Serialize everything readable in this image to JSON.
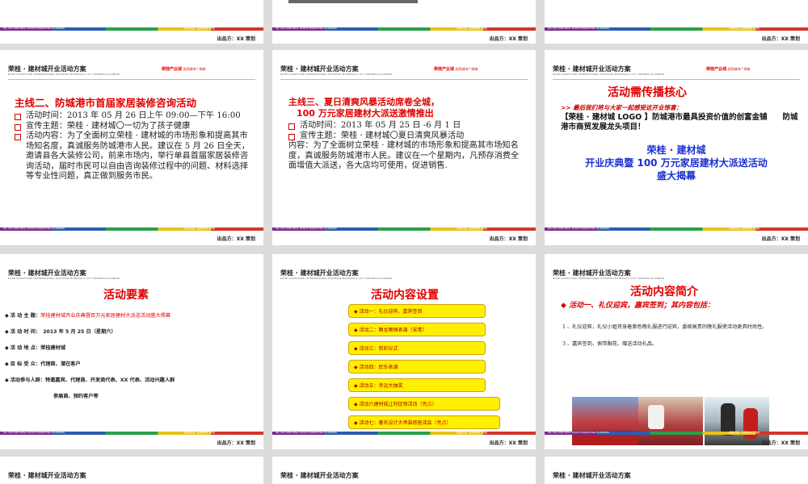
{
  "footer": {
    "stripe_left": "GR. POU RMS REAL ESTATE MARKETING PLANNING",
    "stripe_right": "[荣桂出品 · 优质城市广场城]",
    "by": "出品方：XX 策划"
  },
  "header": {
    "title": "荣桂 · 建材城开业活动方案",
    "subtitle": "ROSE COURTYARD INTERNATIONAL BUILDING MATERIALS CITY OPENING PLANNING",
    "brand": "荣桂产业城",
    "brand_sub": "优质城市广场城"
  },
  "slide4": {
    "heading": "主线二、防城港市首届家居装修咨询活动",
    "b1": "活动时间：2013 年 05 月 26 日上午 09:00—下午 16:00",
    "b2": "宣传主题：荣桂 · 建材城〇一切为了孩子健康",
    "b3": "活动内容：为了全面树立荣桂 · 建材城的市场形象和提高其市场知名度，真诚服务防城港市人民。建议在 5 月 26 日全天，邀请县各大装修公司，前来市场内，举行单县首届家居装修咨询活动，届时市民可以自由咨询装修过程中的问题、材料选择等专业性问题，真正做到服务市民。"
  },
  "slide5": {
    "heading1": "主线三、夏日清爽风暴活动席卷全城，",
    "heading2": "100 万元家居建材大派送激情推出",
    "b1": "活动时间：2013 年 05 月 25 日 -6 月 1 日",
    "b2": "宣传主题：荣桂 · 建材城〇夏日清爽风暴活动",
    "b3": "内容：为了全面树立荣桂 · 建材城的市场形象和提高其市场知名度，真诚服务防城港市人民。建议在一个星期内，凡预存消费全面增值大派送，各大店均可使用，促进销售."
  },
  "slide6": {
    "heading": "活动需传播核心",
    "intro": ">> 最后我们将与大家一起感受这开业惊喜：",
    "line1": "【荣桂 · 建材城 LOGO 】防城港市最具投资价值的创富金铺　　防城港市商贸发展龙头项目！",
    "blue1": "荣桂 · 建材城",
    "blue2": "开业庆典暨 100 万元家居建材大派送活动",
    "blue3": "盛大揭幕"
  },
  "slide7": {
    "heading": "活动要素",
    "r1_label": "活 动 主 题：",
    "r1_value": "荣桂建材城开业庆典暨百万元家居建材大派送活动盛大揭幕",
    "r2": "活 动 时 间：　2013 年 5 月 25 日（星期六）",
    "r3": "活 动 地 点：荣桂建材城",
    "r4": "目 标 受 众：代理商、潜在客户",
    "r5": "活动参与人群：特邀嘉宾、代理商、开发商代表、XX 代表、活动兴趣人群",
    "r6": "参展商、预约客户等"
  },
  "slide8": {
    "heading": "活动内容设置",
    "items": [
      "活动一：礼仪迎宾、嘉宾签到",
      "活动二：舞龙舞狮表演（采青）",
      "活动三：剪彩仪式",
      "活动四：民乐表演",
      "活动五：幸运大抽奖",
      "活动六建材城让利促销活动",
      "活动七：著名设计大师装修座谈会"
    ],
    "highlight": "（亮点）"
  },
  "slide9": {
    "heading": "活动内容简介",
    "sub": "◆ 活动一、礼仪迎宾，嘉宾签到；其内容包括：",
    "p1": "1 、礼仪迎宾，礼仪小姐将身着紫色晚礼服进行迎宾，委婉高贵的晚礼服使活动更具时尚性。",
    "p2": "3 、嘉宾签到、佩带胸花、赠送活动礼品。"
  }
}
